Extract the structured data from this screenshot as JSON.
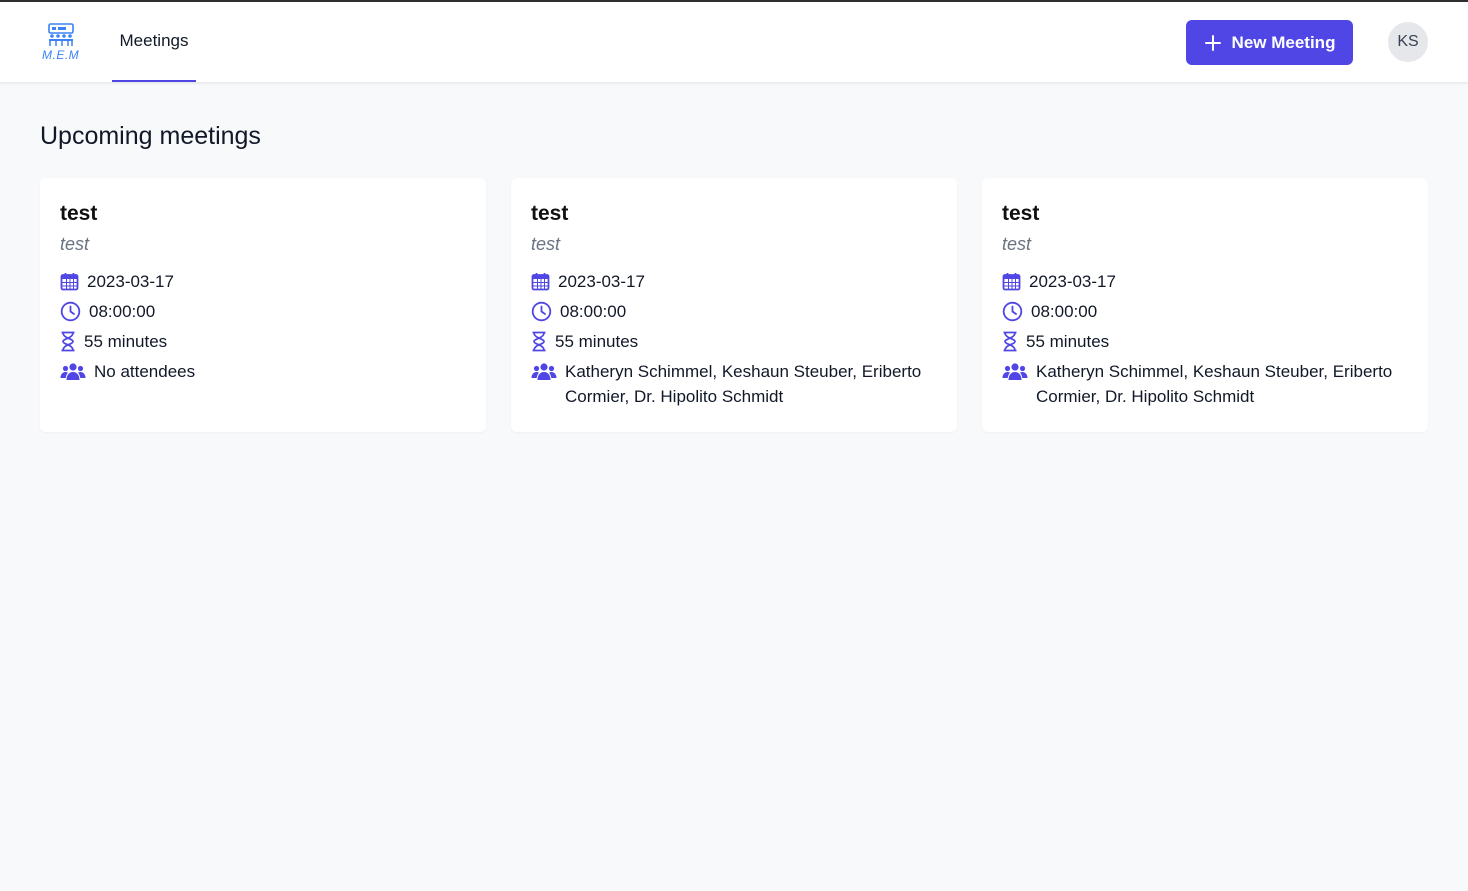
{
  "app": {
    "logo_text": "M.E.M"
  },
  "nav": {
    "tabs": [
      {
        "label": "Meetings",
        "active": true
      }
    ]
  },
  "header": {
    "new_button_label": "New Meeting",
    "user_initials": "KS"
  },
  "main": {
    "title": "Upcoming meetings",
    "meetings": [
      {
        "title": "test",
        "description": "test",
        "date": "2023-03-17",
        "time": "08:00:00",
        "duration": "55 minutes",
        "attendees": "No attendees"
      },
      {
        "title": "test",
        "description": "test",
        "date": "2023-03-17",
        "time": "08:00:00",
        "duration": "55 minutes",
        "attendees": "Katheryn Schimmel, Keshaun Steuber, Eriberto Cormier, Dr. Hipolito Schmidt"
      },
      {
        "title": "test",
        "description": "test",
        "date": "2023-03-17",
        "time": "08:00:00",
        "duration": "55 minutes",
        "attendees": "Katheryn Schimmel, Keshaun Steuber, Eriberto Cormier, Dr. Hipolito Schmidt"
      }
    ]
  },
  "colors": {
    "accent": "#4f46e5",
    "logo": "#3b82f6",
    "background": "#f8f9fb"
  },
  "icons": {
    "logo": "meeting-room-icon",
    "new": "plus-icon",
    "date": "calendar-icon",
    "time": "clock-icon",
    "duration": "hourglass-icon",
    "attendees": "users-icon"
  }
}
